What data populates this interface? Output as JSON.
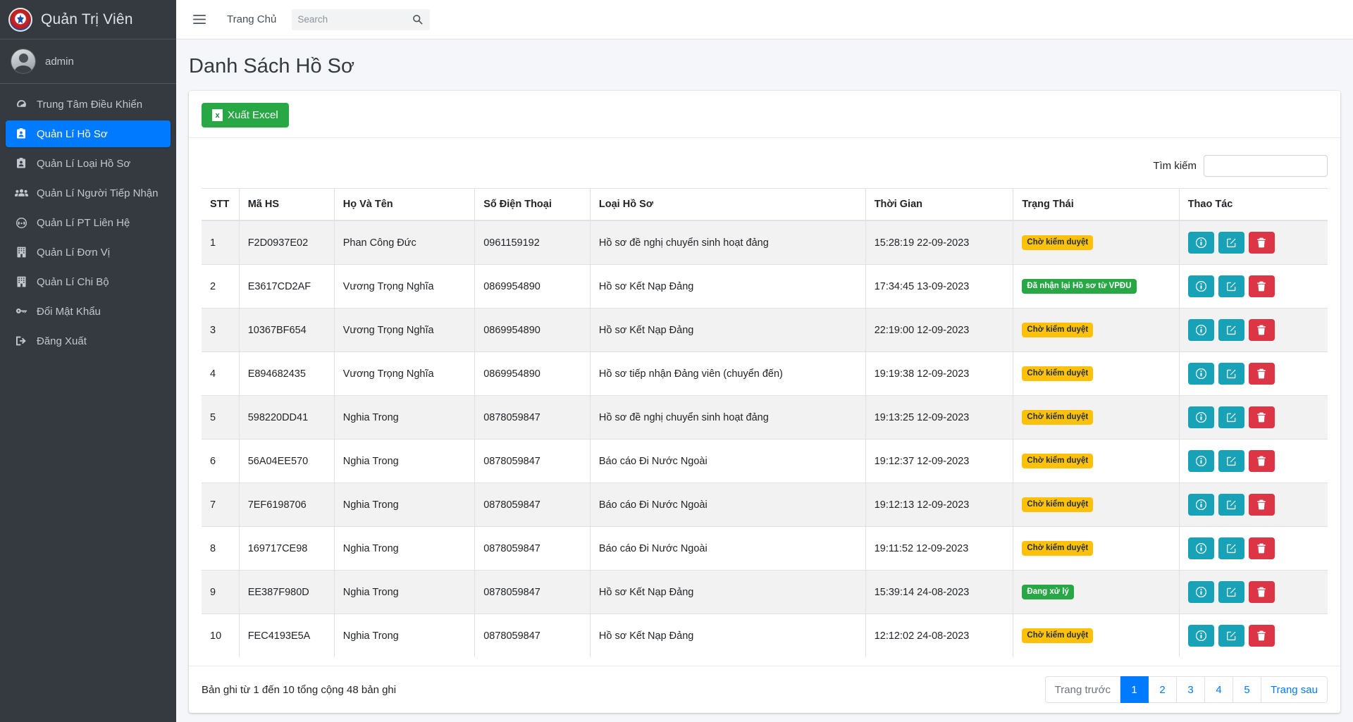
{
  "brand": {
    "title": "Quản Trị Viên",
    "logo_icon": "emblem-logo"
  },
  "user": {
    "name": "admin",
    "avatar_icon": "user-avatar"
  },
  "sidebar": {
    "items": [
      {
        "label": "Trung Tâm Điều Khiển",
        "icon": "dashboard-icon",
        "active": false
      },
      {
        "label": "Quản Lí Hồ Sơ",
        "icon": "id-card-icon",
        "active": true
      },
      {
        "label": "Quản Lí Loại Hồ Sơ",
        "icon": "id-card-icon",
        "active": false
      },
      {
        "label": "Quản Lí Người Tiếp Nhận",
        "icon": "users-icon",
        "active": false
      },
      {
        "label": "Quản Lí PT Liên Hệ",
        "icon": "headset-icon",
        "active": false
      },
      {
        "label": "Quản Lí Đơn Vị",
        "icon": "building-icon",
        "active": false
      },
      {
        "label": "Quản Lí Chi Bộ",
        "icon": "building-icon",
        "active": false
      },
      {
        "label": "Đổi Mật Khẩu",
        "icon": "key-icon",
        "active": false
      },
      {
        "label": "Đăng Xuất",
        "icon": "logout-icon",
        "active": false
      }
    ]
  },
  "topbar": {
    "menu_icon": "hamburger-icon",
    "home_link": "Trang Chủ",
    "search_placeholder": "Search",
    "search_value": "",
    "search_icon": "search-icon"
  },
  "page": {
    "title": "Danh Sách Hồ Sơ"
  },
  "toolbar": {
    "export_label": "Xuất Excel",
    "export_icon": "excel-icon"
  },
  "filter": {
    "label": "Tìm kiếm",
    "value": "",
    "placeholder": ""
  },
  "table": {
    "columns": [
      "STT",
      "Mã HS",
      "Họ Và Tên",
      "Số Điện Thoại",
      "Loại Hồ Sơ",
      "Thời Gian",
      "Trạng Thái",
      "Thao Tác"
    ],
    "rows": [
      {
        "stt": "1",
        "ma": "F2D0937E02",
        "ten": "Phan Công Đức",
        "sdt": "0961159192",
        "loai": "Hồ sơ đề nghị chuyển sinh hoạt đảng",
        "time": "15:28:19 22-09-2023",
        "status": "Chờ kiểm duyệt",
        "status_type": "warning"
      },
      {
        "stt": "2",
        "ma": "E3617CD2AF",
        "ten": "Vương Trọng Nghĩa",
        "sdt": "0869954890",
        "loai": "Hồ sơ Kết Nạp Đảng",
        "time": "17:34:45 13-09-2023",
        "status": "Đã nhận lại Hồ sơ từ VPĐU",
        "status_type": "success"
      },
      {
        "stt": "3",
        "ma": "10367BF654",
        "ten": "Vương Trọng Nghĩa",
        "sdt": "0869954890",
        "loai": "Hồ sơ Kết Nạp Đảng",
        "time": "22:19:00 12-09-2023",
        "status": "Chờ kiểm duyệt",
        "status_type": "warning"
      },
      {
        "stt": "4",
        "ma": "E894682435",
        "ten": "Vương Trọng Nghĩa",
        "sdt": "0869954890",
        "loai": "Hồ sơ tiếp nhận Đảng viên (chuyển đến)",
        "time": "19:19:38 12-09-2023",
        "status": "Chờ kiểm duyệt",
        "status_type": "warning"
      },
      {
        "stt": "5",
        "ma": "598220DD41",
        "ten": "Nghia Trong",
        "sdt": "0878059847",
        "loai": "Hồ sơ đề nghị chuyển sinh hoạt đảng",
        "time": "19:13:25 12-09-2023",
        "status": "Chờ kiểm duyệt",
        "status_type": "warning"
      },
      {
        "stt": "6",
        "ma": "56A04EE570",
        "ten": "Nghia Trong",
        "sdt": "0878059847",
        "loai": "Báo cáo Đi Nước Ngoài",
        "time": "19:12:37 12-09-2023",
        "status": "Chờ kiểm duyệt",
        "status_type": "warning"
      },
      {
        "stt": "7",
        "ma": "7EF6198706",
        "ten": "Nghia Trong",
        "sdt": "0878059847",
        "loai": "Báo cáo Đi Nước Ngoài",
        "time": "19:12:13 12-09-2023",
        "status": "Chờ kiểm duyệt",
        "status_type": "warning"
      },
      {
        "stt": "8",
        "ma": "169717CE98",
        "ten": "Nghia Trong",
        "sdt": "0878059847",
        "loai": "Báo cáo Đi Nước Ngoài",
        "time": "19:11:52 12-09-2023",
        "status": "Chờ kiểm duyệt",
        "status_type": "warning"
      },
      {
        "stt": "9",
        "ma": "EE387F980D",
        "ten": "Nghia Trong",
        "sdt": "0878059847",
        "loai": "Hồ sơ Kết Nạp Đảng",
        "time": "15:39:14 24-08-2023",
        "status": "Đang xử lý",
        "status_type": "success"
      },
      {
        "stt": "10",
        "ma": "FEC4193E5A",
        "ten": "Nghia Trong",
        "sdt": "0878059847",
        "loai": "Hồ sơ Kết Nạp Đảng",
        "time": "12:12:02 24-08-2023",
        "status": "Chờ kiểm duyệt",
        "status_type": "warning"
      }
    ],
    "action_icons": [
      "info-icon",
      "edit-icon",
      "trash-icon"
    ]
  },
  "footer": {
    "records_info": "Bản ghi từ 1 đến 10 tổng cộng 48 bản ghi",
    "pagination": [
      {
        "label": "Trang trước",
        "type": "muted"
      },
      {
        "label": "1",
        "type": "active"
      },
      {
        "label": "2",
        "type": "normal"
      },
      {
        "label": "3",
        "type": "normal"
      },
      {
        "label": "4",
        "type": "normal"
      },
      {
        "label": "5",
        "type": "normal"
      },
      {
        "label": "Trang sau",
        "type": "normal"
      }
    ]
  },
  "colors": {
    "sidebar_bg": "#343a40",
    "accent_blue": "#007bff",
    "success_green": "#28a745",
    "warning_yellow": "#ffc107",
    "danger_red": "#dc3545",
    "info_teal": "#17a2b8"
  }
}
